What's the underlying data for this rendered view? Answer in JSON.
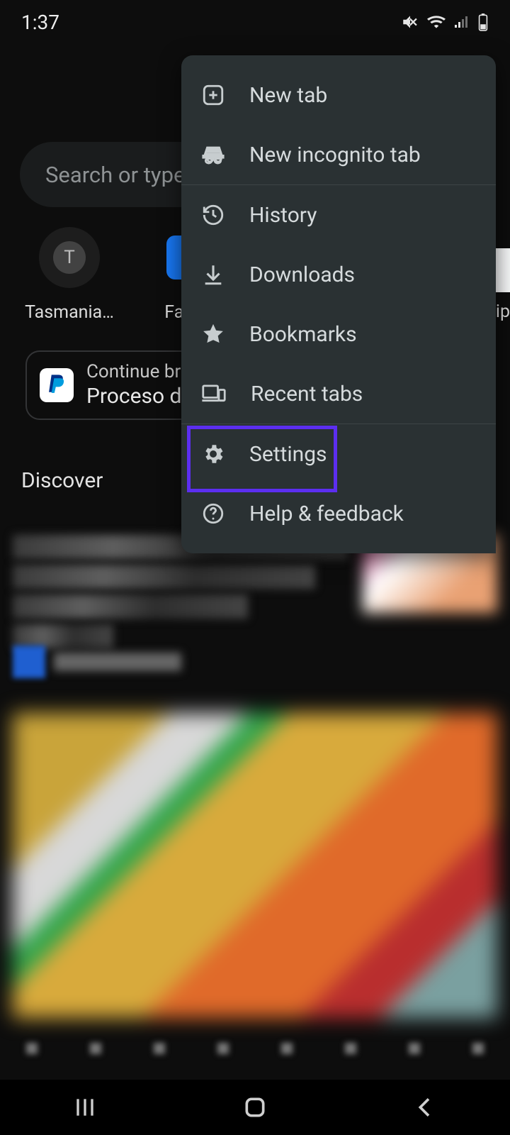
{
  "status": {
    "time": "1:37"
  },
  "search": {
    "placeholder": "Search or type w"
  },
  "shortcuts": [
    {
      "label": "Tasmania…",
      "initial": "T",
      "kind": "letter"
    },
    {
      "label": "Faceb",
      "kind": "fb"
    },
    {
      "label": "ip",
      "kind": "edge"
    }
  ],
  "continue_card": {
    "line1": "Continue brow",
    "line2": "Proceso de"
  },
  "discover": {
    "heading": "Discover"
  },
  "menu": {
    "items": [
      {
        "label": "New tab",
        "icon": "plus-square-icon"
      },
      {
        "label": "New incognito tab",
        "icon": "incognito-icon"
      },
      {
        "label": "History",
        "icon": "history-icon"
      },
      {
        "label": "Downloads",
        "icon": "download-icon"
      },
      {
        "label": "Bookmarks",
        "icon": "star-icon"
      },
      {
        "label": "Recent tabs",
        "icon": "devices-icon"
      },
      {
        "label": "Settings",
        "icon": "gear-icon",
        "highlighted": true
      },
      {
        "label": "Help & feedback",
        "icon": "question-icon"
      }
    ]
  },
  "colors": {
    "menu_bg": "#2a3133",
    "highlight": "#5c2ef0"
  }
}
